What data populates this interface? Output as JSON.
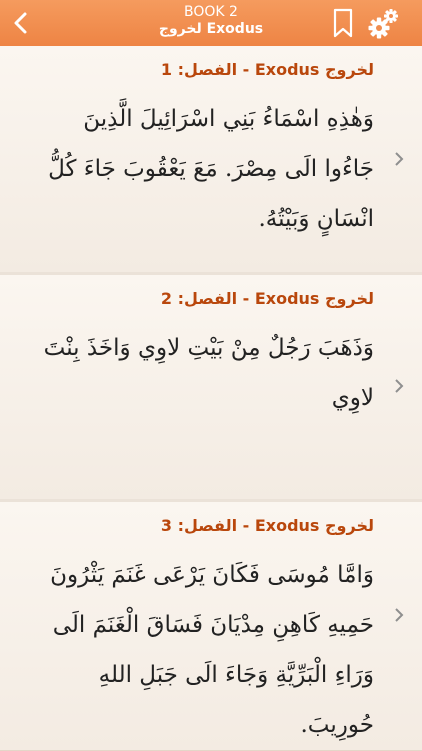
{
  "header": {
    "book_label": "BOOK 2",
    "book_subtitle": "لخروج Exodus",
    "back_icon": "chevron-left-icon",
    "bookmark_icon": "bookmark-icon",
    "settings_icon": "gear-icon"
  },
  "colors": {
    "header_bg": "#f08d4f",
    "heading_text": "#b9470c",
    "page_bg": "#f7f0e9"
  },
  "verses": [
    {
      "heading": "لخروج Exodus - الفصل: 1",
      "text": "وَهٰذِهِ اسْمَاءُ بَنِي اسْرَائِيلَ الَّذِينَ جَاءُوا الَى مِصْرَ. مَعَ يَعْقُوبَ جَاءَ كُلُّ انْسَانٍ وَبَيْتُهُ."
    },
    {
      "heading": "لخروج Exodus - الفصل: 2",
      "text": "وَذَهَبَ رَجُلٌ مِنْ بَيْتِ لاوِي وَاخَذَ بِنْتَ لاوِي"
    },
    {
      "heading": "لخروج Exodus - الفصل: 3",
      "text": "وَامَّا مُوسَى فَكَانَ يَرْعَى غَنَمَ يَثْرُونَ حَمِيهِ كَاهِنِ مِدْيَانَ فَسَاقَ الْغَنَمَ الَى وَرَاءِ الْبَرِّيَّةِ وَجَاءَ الَى جَبَلِ اللهِ حُورِيبَ."
    }
  ]
}
